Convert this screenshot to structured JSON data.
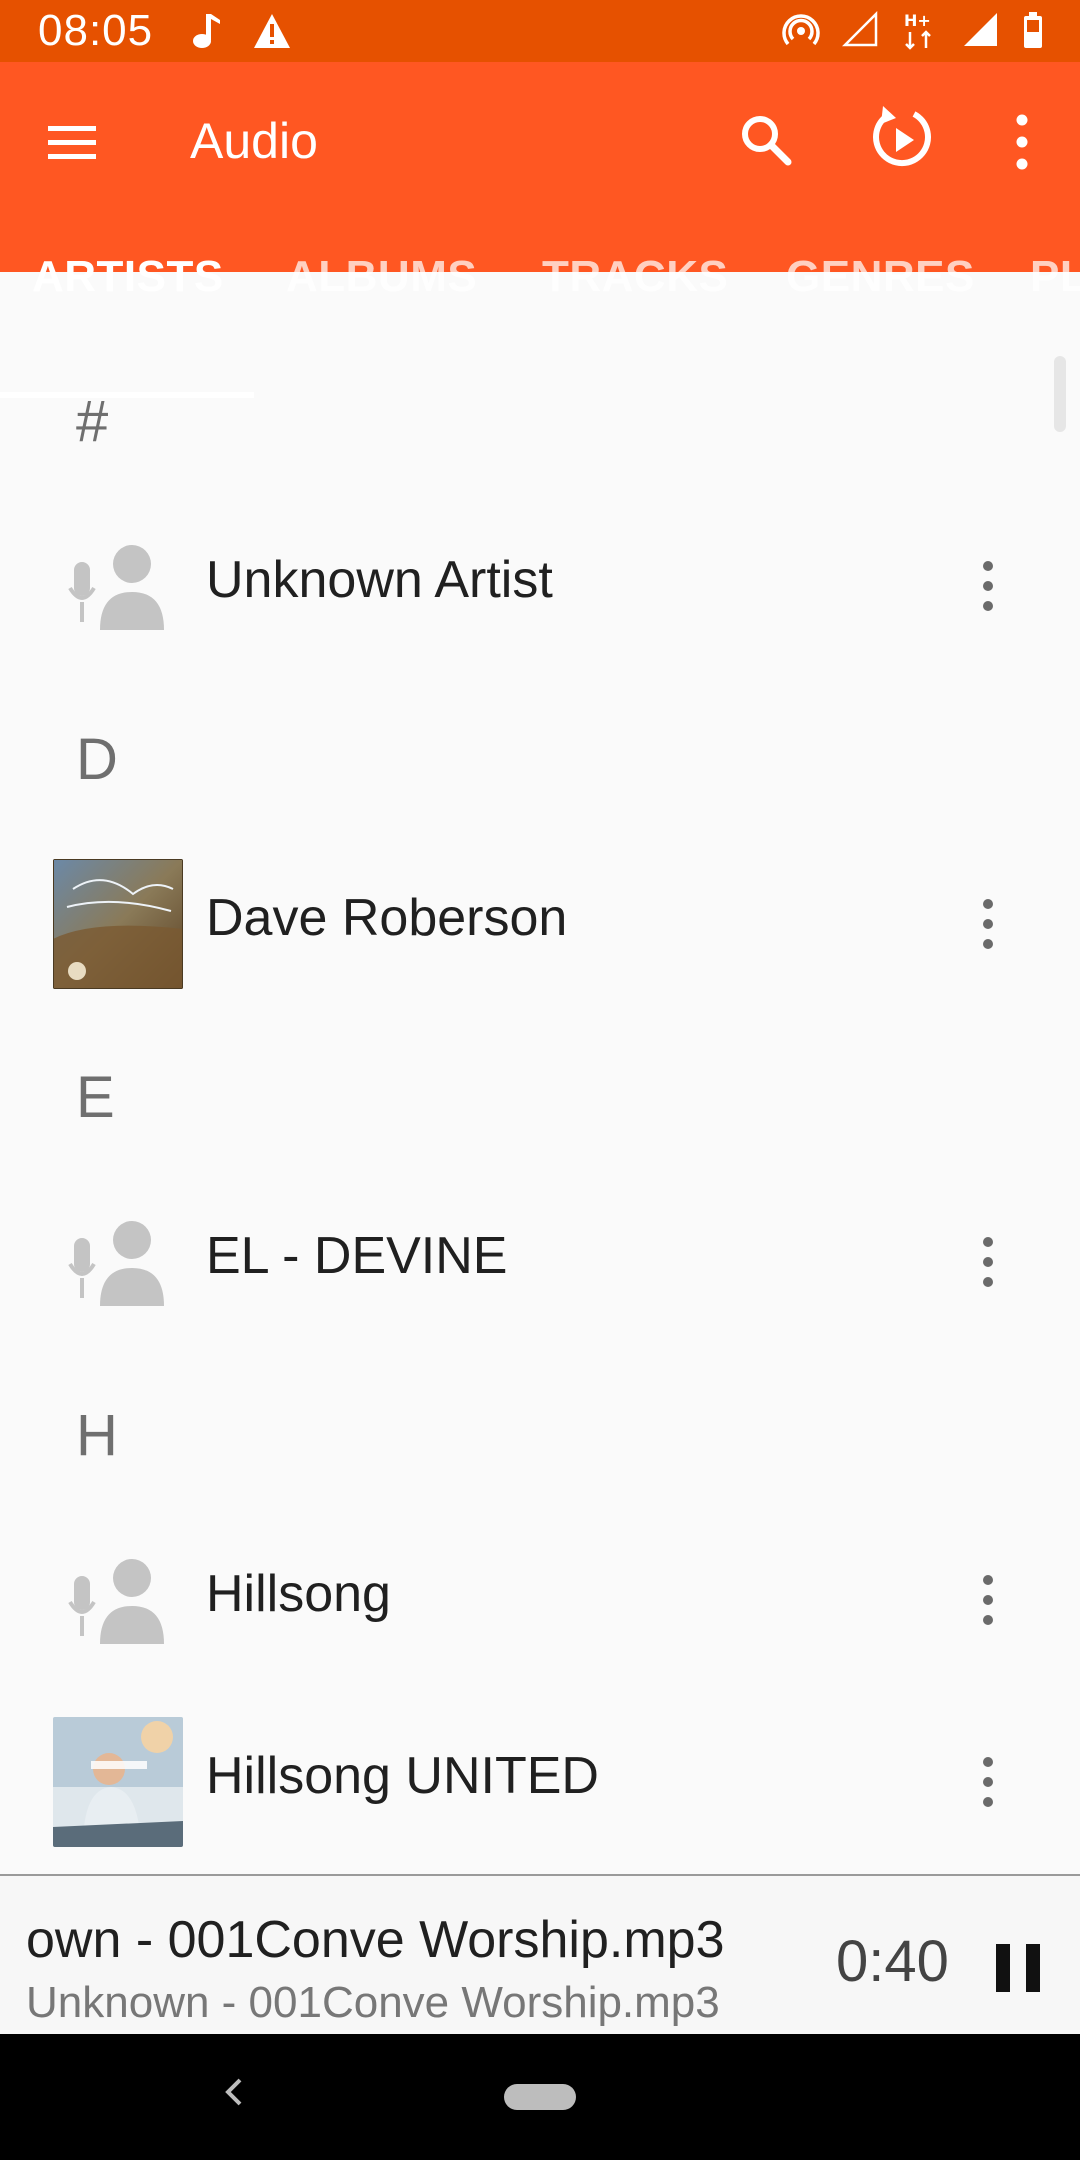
{
  "status": {
    "time": "08:05",
    "left_icons": [
      "music-note-icon",
      "warning-icon"
    ],
    "right_icons": [
      "hotspot-icon",
      "signal-empty-icon",
      "hplus-data-icon",
      "signal-full-icon",
      "battery-icon"
    ]
  },
  "toolbar": {
    "title": "Audio",
    "icons": [
      "menu-icon",
      "search-icon",
      "resume-playback-icon",
      "overflow-icon"
    ]
  },
  "tabs": [
    {
      "label": "ARTISTS",
      "active": true
    },
    {
      "label": "ALBUMS",
      "active": false
    },
    {
      "label": "TRACKS",
      "active": false
    },
    {
      "label": "GENRES",
      "active": false
    },
    {
      "label": "PL",
      "active": false
    }
  ],
  "list": {
    "items": [
      {
        "type": "header",
        "label": "#"
      },
      {
        "type": "artist",
        "name": "Unknown Artist",
        "art": "placeholder"
      },
      {
        "type": "header",
        "label": "D"
      },
      {
        "type": "artist",
        "name": "Dave Roberson",
        "art": "album-art-dave"
      },
      {
        "type": "header",
        "label": "E"
      },
      {
        "type": "artist",
        "name": "EL - DEVINE",
        "art": "placeholder"
      },
      {
        "type": "header",
        "label": "H"
      },
      {
        "type": "artist",
        "name": "Hillsong",
        "art": "placeholder"
      },
      {
        "type": "artist",
        "name": "Hillsong UNITED",
        "art": "album-art-hillsong-united"
      }
    ]
  },
  "player": {
    "title": "own - 001Conve Worship.mp3",
    "subtitle": "Unknown - 001Conve Worship.mp3",
    "time": "0:40"
  },
  "colors": {
    "status_bar": "#e65100",
    "toolbar": "#ff5722",
    "background": "#fafafa"
  }
}
